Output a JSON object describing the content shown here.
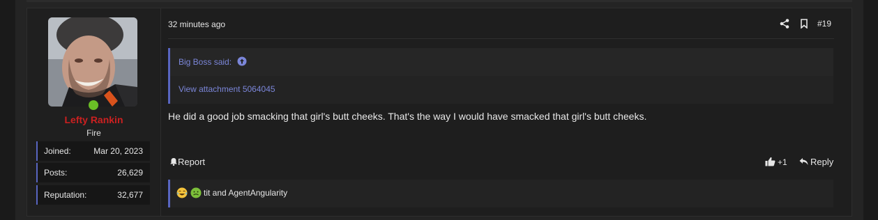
{
  "user": {
    "name": "Lefty Rankin",
    "title": "Fire",
    "stats": [
      {
        "label": "Joined:",
        "value": "Mar 20, 2023"
      },
      {
        "label": "Posts:",
        "value": "26,629"
      },
      {
        "label": "Reputation:",
        "value": "32,677"
      }
    ],
    "online": true,
    "name_color": "#cc2020"
  },
  "post": {
    "time": "32 minutes ago",
    "number": "#19",
    "quote": {
      "author": "Big Boss said:",
      "attachment": "View attachment 5064045"
    },
    "text": "He did a good job smacking that girl's butt cheeks. That's the way I would have smacked that girl's butt cheeks.",
    "actions": {
      "report": "Report",
      "like_count": "+1",
      "reply": "Reply"
    },
    "reactions": {
      "emojis": [
        "laughing-crying-emoji",
        "nauseated-emoji"
      ],
      "users": "tit and AgentAngularity"
    }
  },
  "colors": {
    "accent": "#5865c0",
    "link": "#7b86d9",
    "background": "#1e1e1e"
  }
}
